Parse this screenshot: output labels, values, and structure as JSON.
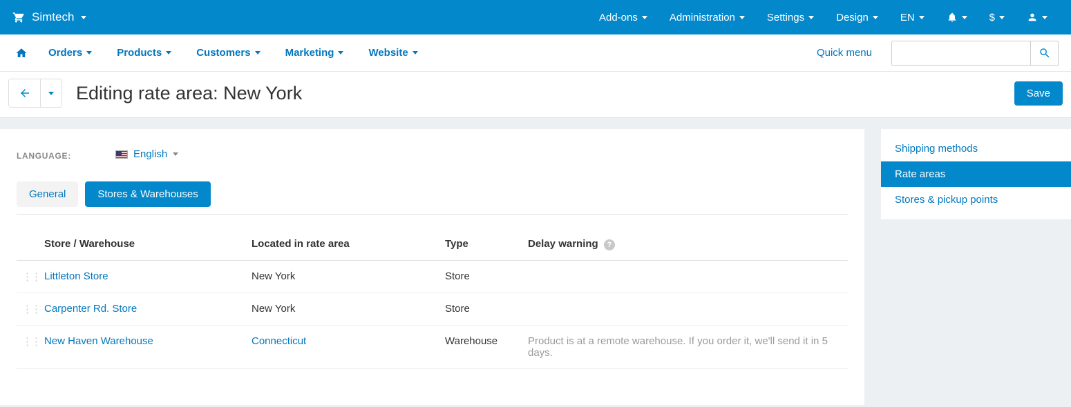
{
  "topbar": {
    "brand": "Simtech",
    "menus": {
      "addons": "Add-ons",
      "administration": "Administration",
      "settings": "Settings",
      "design": "Design",
      "language": "EN",
      "currency": "$"
    }
  },
  "subnav": {
    "orders": "Orders",
    "products": "Products",
    "customers": "Customers",
    "marketing": "Marketing",
    "website": "Website",
    "quick_menu": "Quick menu"
  },
  "search": {
    "value": ""
  },
  "page": {
    "title": "Editing rate area: New York",
    "save_label": "Save"
  },
  "language_selector": {
    "label": "LANGUAGE:",
    "value": "English"
  },
  "tabs": {
    "general": "General",
    "stores": "Stores & Warehouses"
  },
  "table": {
    "headers": {
      "name": "Store / Warehouse",
      "area": "Located in rate area",
      "type": "Type",
      "delay": "Delay warning"
    },
    "rows": [
      {
        "name": "Littleton Store",
        "area": "New York",
        "area_link": false,
        "type": "Store",
        "delay": ""
      },
      {
        "name": "Carpenter Rd. Store",
        "area": "New York",
        "area_link": false,
        "type": "Store",
        "delay": ""
      },
      {
        "name": "New Haven Warehouse",
        "area": "Connecticut",
        "area_link": true,
        "type": "Warehouse",
        "delay": "Product is at a remote warehouse. If you order it, we'll send it in 5 days."
      }
    ]
  },
  "sidebar": {
    "items": [
      {
        "label": "Shipping methods",
        "active": false
      },
      {
        "label": "Rate areas",
        "active": true
      },
      {
        "label": "Stores & pickup points",
        "active": false
      }
    ]
  }
}
